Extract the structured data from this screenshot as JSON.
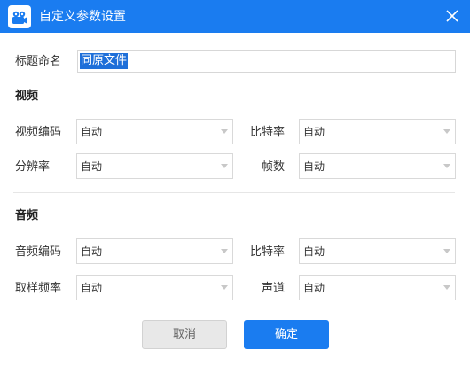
{
  "window": {
    "title": "自定义参数设置"
  },
  "name_row": {
    "label": "标题命名",
    "value": "同原文件"
  },
  "video": {
    "section_title": "视频",
    "codec_label": "视频编码",
    "codec_value": "自动",
    "bitrate_label": "比特率",
    "bitrate_value": "自动",
    "resolution_label": "分辨率",
    "resolution_value": "自动",
    "fps_label": "帧数",
    "fps_value": "自动"
  },
  "audio": {
    "section_title": "音频",
    "codec_label": "音频编码",
    "codec_value": "自动",
    "bitrate_label": "比特率",
    "bitrate_value": "自动",
    "samplerate_label": "取样频率",
    "samplerate_value": "自动",
    "channel_label": "声道",
    "channel_value": "自动"
  },
  "buttons": {
    "cancel": "取消",
    "ok": "确定"
  },
  "colors": {
    "accent": "#1a7cf0",
    "selection": "#1e6fd9"
  }
}
